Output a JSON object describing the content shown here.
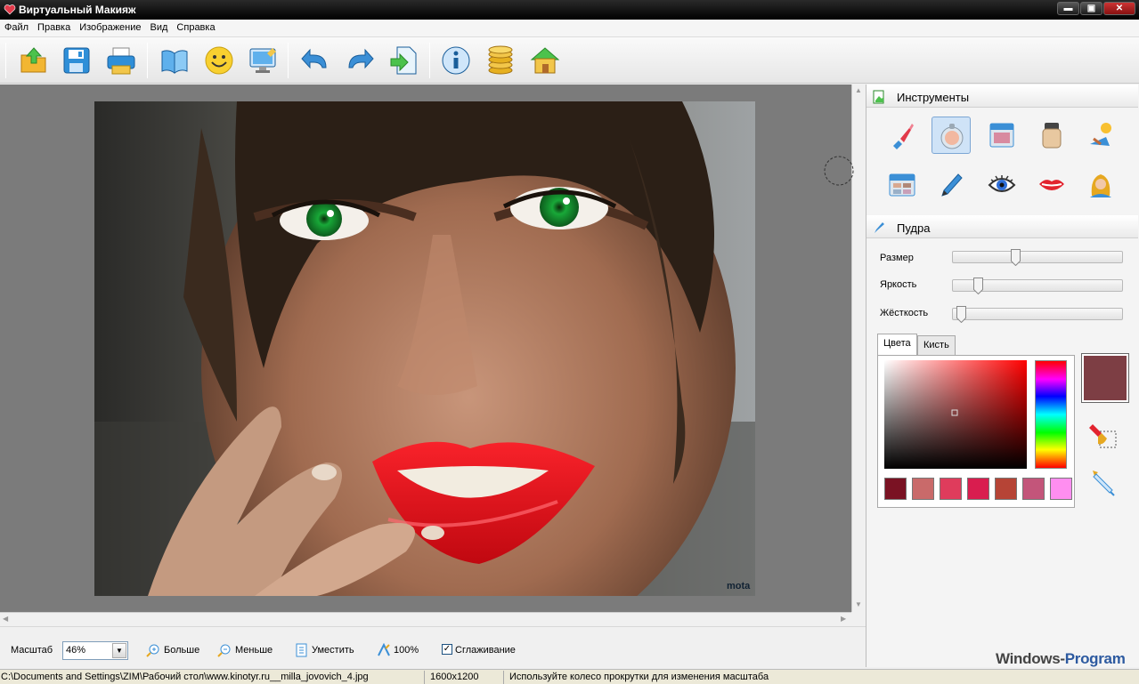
{
  "window": {
    "title": "Виртуальный Макияж",
    "controls": {
      "minimize": "▬",
      "maximize": "▣",
      "close": "✕"
    }
  },
  "menu": {
    "items": [
      "Файл",
      "Правка",
      "Изображение",
      "Вид",
      "Справка"
    ]
  },
  "toolbar": {
    "buttons": [
      "open-icon",
      "save-icon",
      "print-icon",
      "book-icon",
      "smiley-icon",
      "monitor-icon",
      "undo-icon",
      "redo-icon",
      "export-icon",
      "info-icon",
      "coins-icon",
      "home-icon"
    ]
  },
  "tools_panel": {
    "title": "Инструменты",
    "tools": [
      "lipstick-icon",
      "powder-compact-icon",
      "blush-palette-icon",
      "foundation-jar-icon",
      "tanning-icon",
      "eyeshadow-palette-icon",
      "eye-pencil-icon",
      "eye-icon",
      "lips-icon",
      "hair-color-icon"
    ],
    "selected_tool": "powder-compact-icon"
  },
  "powder_panel": {
    "title": "Пудра",
    "sliders": [
      {
        "label": "Размер",
        "value": 0.36
      },
      {
        "label": "Яркость",
        "value": 0.13
      },
      {
        "label": "Жёсткость",
        "value": 0.02
      }
    ],
    "tabs": [
      "Цвета",
      "Кисть"
    ],
    "active_tab": "Цвета",
    "current_color": "#7d3e44",
    "swatches": [
      "#7a1223",
      "#c96a6a",
      "#df3c5c",
      "#d91d4f",
      "#b64436",
      "#c3557a",
      "#ff8ef0"
    ]
  },
  "bottom_bar": {
    "zoom_label": "Масштаб",
    "zoom_value": "46%",
    "zoom_in": "Больше",
    "zoom_out": "Меньше",
    "fit": "Уместить",
    "actual_size": "100%",
    "smoothing": "Сглаживание",
    "smoothing_checked": true
  },
  "status_bar": {
    "path": "C:\\Documents and Settings\\ZIM\\Рабочий стол\\www.kinotyr.ru__milla_jovovich_4.jpg",
    "dimensions": "1600x1200",
    "hint": "Используйте колесо прокрутки для изменения масштаба"
  },
  "watermark": {
    "part1": "Windows-",
    "part2": "Program"
  },
  "photo_watermark": "mota"
}
